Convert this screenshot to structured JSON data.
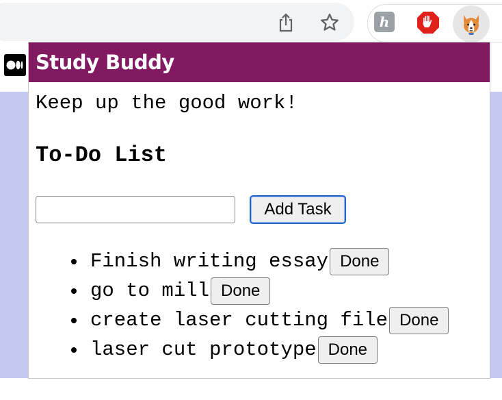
{
  "browser": {
    "toolbar_icons": [
      "share-icon",
      "star-icon"
    ],
    "extensions": [
      {
        "name": "honey-extension-icon",
        "glyph": "h"
      },
      {
        "name": "adblock-extension-icon"
      },
      {
        "name": "corgi-extension-icon"
      }
    ]
  },
  "page": {
    "site_logo": "medium-logo-icon"
  },
  "popup": {
    "title": "Study Buddy",
    "encouragement": "Keep up the good work!",
    "todo_heading": "To-Do List",
    "task_input": {
      "value": "",
      "placeholder": ""
    },
    "add_button_label": "Add Task",
    "tasks": [
      {
        "text": "Finish writing essay",
        "done_label": "Done"
      },
      {
        "text": "go to mill",
        "done_label": "Done"
      },
      {
        "text": "create laser cutting file",
        "done_label": "Done"
      },
      {
        "text": "laser cut prototype",
        "done_label": "Done"
      }
    ]
  },
  "colors": {
    "header": "#821a62",
    "page_background": "#c5c8ee",
    "focus_ring": "#1f64c8"
  }
}
